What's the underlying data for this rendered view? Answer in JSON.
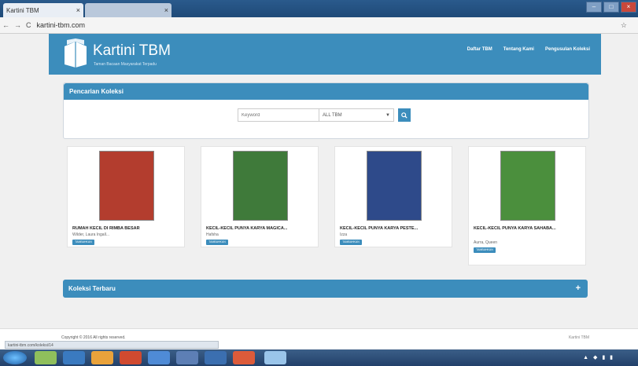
{
  "browser": {
    "tab1_title": "Kartini TBM",
    "tab2_title": "",
    "tab_close": "×",
    "url": "kartini-tbm.com",
    "back": "←",
    "forward": "→",
    "reload": "C",
    "star": "☆"
  },
  "header": {
    "brand": "Kartini TBM",
    "tagline": "Taman Bacaan Masyarakat Terpadu",
    "nav": [
      "Daftar TBM",
      "Tentang Kami",
      "Pengusulan Koleksi"
    ]
  },
  "search": {
    "panel_title": "Pencarian Koleksi",
    "placeholder": "Keyword",
    "select_value": "ALL TBM",
    "button_icon": "search-icon"
  },
  "books": [
    {
      "title": "RUMAH KECIL DI RIMBA BESAR",
      "author": "Wilder, Laura Ingall...",
      "button": "TAMBAHKAN",
      "cover_color": "#b33d2e"
    },
    {
      "title": "KECIL-KECIL PUNYA KARYA MAGICA...",
      "author": "Hafsha",
      "button": "TAMBAHKAN",
      "cover_color": "#3f7a3a"
    },
    {
      "title": "KECIL-KECIL PUNYA KARYA PESTE...",
      "author": "Izza",
      "button": "TAMBAHKAN",
      "cover_color": "#2e4a8a"
    },
    {
      "title": "KECIL-KECIL PUNYA KARYA SAHABA...",
      "author": "Aurra, Queen",
      "button": "TAMBAHKAN",
      "cover_color": "#4b8f3d"
    }
  ],
  "latest": {
    "title": "Koleksi Terbaru",
    "toggle": "+"
  },
  "footer": {
    "copyright": "Copyright © 2016 All rights reserved.",
    "right": "Kartini TBM"
  },
  "status_url": "kartini-tbm.com/koleksi/14",
  "colors": {
    "primary": "#3c8dbc"
  }
}
